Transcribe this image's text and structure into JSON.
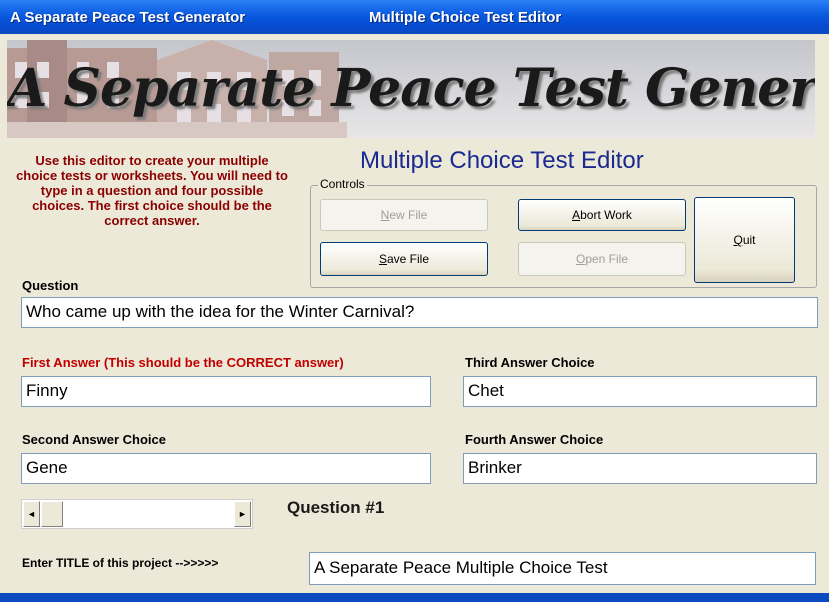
{
  "window": {
    "app_title": "A Separate Peace Test Generator",
    "form_title": "Multiple Choice Test Editor"
  },
  "banner": {
    "title": "A Separate Peace Test Generator"
  },
  "instructions": "Use this editor to create your multiple choice tests or worksheets.  You will need to type in a question and four possible choices.  The first choice should be the correct answer.",
  "editor_title": "Multiple Choice Test Editor",
  "controls": {
    "legend": "Controls",
    "new_file": {
      "accel": "N",
      "rest": "ew File",
      "enabled": false
    },
    "abort_work": {
      "accel": "A",
      "rest": "bort Work",
      "enabled": true
    },
    "quit": {
      "accel": "Q",
      "rest": "uit",
      "enabled": true
    },
    "save_file": {
      "accel": "S",
      "rest": "ave File",
      "enabled": true
    },
    "open_file": {
      "accel": "O",
      "rest": "pen File",
      "enabled": false
    }
  },
  "question": {
    "label": "Question",
    "value": "Who came up with the idea for the Winter Carnival?"
  },
  "answers": {
    "first": {
      "label": "First Answer (This should be the CORRECT answer)",
      "value": "Finny"
    },
    "second": {
      "label": "Second Answer Choice",
      "value": "Gene"
    },
    "third": {
      "label": "Third Answer Choice",
      "value": "Chet"
    },
    "fourth": {
      "label": "Fourth Answer Choice",
      "value": "Brinker"
    }
  },
  "navigator": {
    "left_arrow": "◄",
    "right_arrow": "►",
    "question_number": "Question #1",
    "position_fraction": 0.0
  },
  "project_title": {
    "label": "Enter TITLE of this project -->>>>>",
    "value": "A Separate Peace Multiple Choice Test"
  },
  "colors": {
    "titlebar": "#0a5ae0",
    "instructions_text": "#8b0000",
    "first_answer_label": "#c00000",
    "editor_title": "#1a2a8f"
  }
}
